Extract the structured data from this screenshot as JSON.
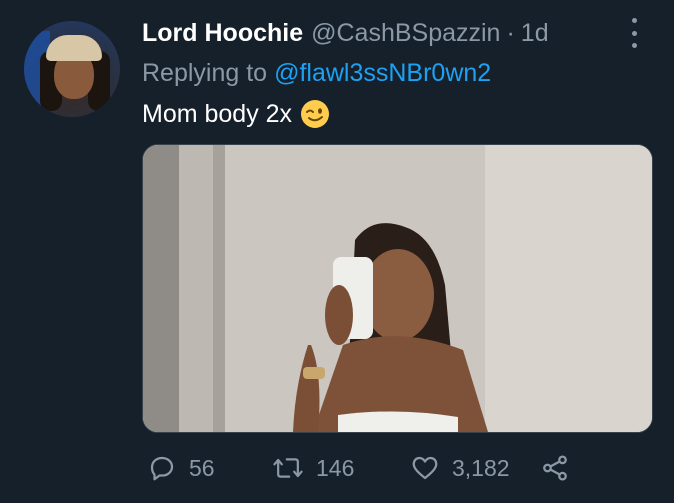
{
  "tweet": {
    "author_name": "Lord Hoochie",
    "author_handle": "@CashBSpazzin",
    "separator": "·",
    "time_ago": "1d",
    "replying_prefix": "Replying to",
    "replying_to": "@flawl3ssNBr0wn2",
    "text": "Mom body 2x",
    "emoji": "winking-face",
    "media": "image"
  },
  "actions": {
    "replies": "56",
    "retweets": "146",
    "likes": "3,182"
  },
  "icons": {
    "reply": "reply-icon",
    "retweet": "retweet-icon",
    "like": "heart-icon",
    "share": "share-icon",
    "more": "more-options-icon"
  },
  "colors": {
    "background": "#15202b",
    "primary_text": "#ffffff",
    "secondary_text": "#8b98a5",
    "link": "#1da1f2"
  }
}
